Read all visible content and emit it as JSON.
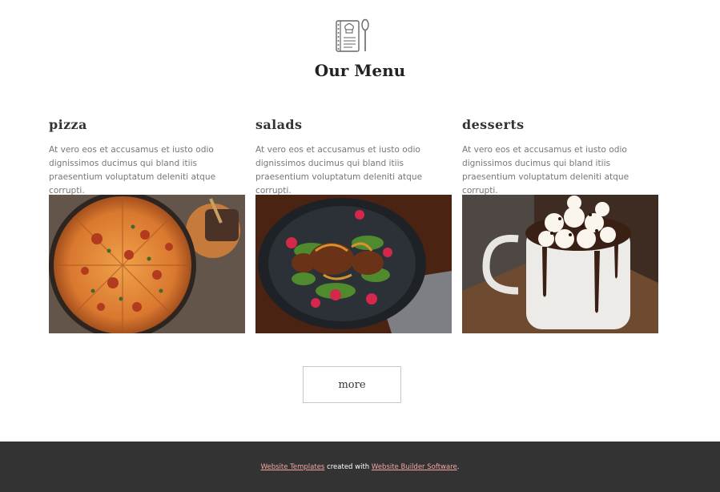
{
  "header": {
    "icon": "recipe-book-spoon-icon",
    "title": "Our Menu"
  },
  "menu": {
    "items": [
      {
        "name": "pizza",
        "description": "At vero eos et accusamus et iusto odio dignissimos ducimus qui bland itiis praesentium voluptatum deleniti atque corrupti.",
        "image": "pizza-photo"
      },
      {
        "name": "salads",
        "description": "At vero eos et accusamus et iusto odio dignissimos ducimus qui bland itiis praesentium voluptatum deleniti atque corrupti.",
        "image": "salad-photo"
      },
      {
        "name": "desserts",
        "description": "At vero eos et accusamus et iusto odio dignissimos ducimus qui bland itiis praesentium voluptatum deleniti atque corrupti.",
        "image": "hot-chocolate-photo"
      }
    ],
    "more_label": "more"
  },
  "footer": {
    "link1": "Website Templates",
    "middle": " created with ",
    "link2": "Website Builder Software",
    "end": "."
  },
  "colors": {
    "footer_bg": "#333333",
    "footer_link": "#f4a7a0",
    "text_gray": "#777777"
  }
}
